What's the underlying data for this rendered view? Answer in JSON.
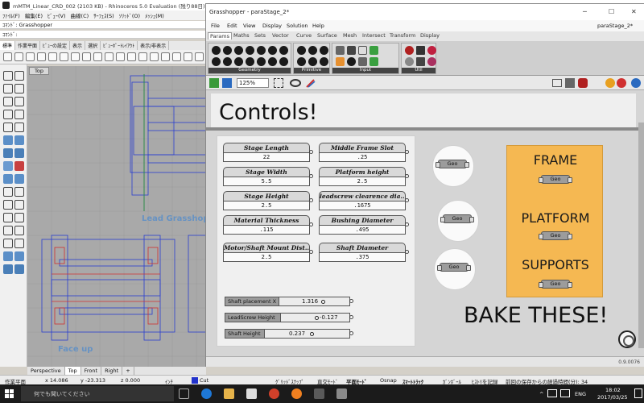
{
  "rhino": {
    "title": "mMTM_Linear_CRD_002 (2103 KB) - Rhinoceros 5.0 Evaluation (残り88日) - [Top]",
    "menu": [
      "ﾌｧｲﾙ(F)",
      "編集(E)",
      "ﾋﾞｭｰ(V)",
      "曲線(C)",
      "ｻｰﾌｪｽ(S)",
      "ｿﾘｯﾄﾞ(O)",
      "ﾒｯｼｭ(M)"
    ],
    "command_history": "ｺﾏﾝﾄﾞ: Grasshopper",
    "command_prompt": "ｺﾏﾝﾄﾞ:",
    "toolbar_tabs": [
      "標準",
      "作業平面",
      "ﾋﾞｭｰの設定",
      "表示",
      "選択",
      "ﾋﾞｭｰﾎﾟｰﾄﾚｲｱｳﾄ",
      "表示/非表示"
    ],
    "viewport_label": "Top",
    "viewport_annotations": [
      "Lead Grasshopper",
      "Face up"
    ],
    "viewport_tabs": [
      "Perspective",
      "Top",
      "Front",
      "Right"
    ],
    "status": {
      "cplane": "作業平面",
      "x": "x 14.086",
      "y": "y -23.313",
      "z": "z 0.000",
      "unit": "ｲﾝﾁ",
      "layer": "Cut",
      "grid_snap": "ｸﾞﾘｯﾄﾞｽﾅｯﾌﾟ",
      "ortho": "直交ﾓｰﾄﾞ",
      "planar": "平面ﾓｰﾄﾞ",
      "osnap": "Osnap",
      "smart_track": "ｽﾏｰﾄﾄﾗｯｸ",
      "gumball": "ｶﾞﾝﾎﾞｰﾙ",
      "history": "ﾋｽﾄﾘを記録",
      "autosave": "前回の保存からの経過時間(分): 34"
    }
  },
  "taskbar": {
    "search_placeholder": "何でも聞いてください",
    "lang": "ENG",
    "time": "18:02",
    "date": "2017/03/25"
  },
  "grasshopper": {
    "title": "Grasshopper - paraStage_2*",
    "doc_name": "paraStage_2*",
    "menu": [
      "File",
      "Edit",
      "View",
      "Display",
      "Solution",
      "Help"
    ],
    "ribbon_tabs": [
      "Params",
      "Maths",
      "Sets",
      "Vector",
      "Curve",
      "Surface",
      "Mesh",
      "Intersect",
      "Transform",
      "Display"
    ],
    "ribbon_groups": [
      "Geometry",
      "Primitive",
      "Input",
      "Util"
    ],
    "zoom": "125%",
    "status_value": "0.9.0076",
    "canvas": {
      "title": "Controls!",
      "sliders": [
        {
          "label": "Stage Length",
          "value": "22"
        },
        {
          "label": "Middle Frame Slot",
          "value": ".25"
        },
        {
          "label": "Stage Width",
          "value": "5.5"
        },
        {
          "label": "Platform height",
          "value": "2.5"
        },
        {
          "label": "Stage Height",
          "value": "2.5"
        },
        {
          "label": "leadscrew clearence dia...",
          "value": ".1675"
        },
        {
          "label": "Material Thickness",
          "value": ".115"
        },
        {
          "label": "Bushing Diameter",
          "value": ".495"
        },
        {
          "label": "Motor/Shaft Mount Dist...",
          "value": "2.5"
        },
        {
          "label": "Shaft Diameter",
          "value": ".375"
        }
      ],
      "number_sliders": [
        {
          "label": "Shaft placement X",
          "value": "1.316"
        },
        {
          "label": "LeadScrew Height",
          "value": "-0.127"
        },
        {
          "label": "Shaft Height",
          "value": "0.237"
        }
      ],
      "geo_label": "Geo",
      "bake_group": [
        "FRAME",
        "PLATFORM",
        "SUPPORTS"
      ],
      "bake_text": "BAKE THESE!"
    }
  },
  "colors": {
    "orange_group": "#f5b852",
    "gh_canvas": "#d5d5d5",
    "rhino_viewport": "#a9a9a9",
    "taskbar": "#1b1b1b"
  }
}
